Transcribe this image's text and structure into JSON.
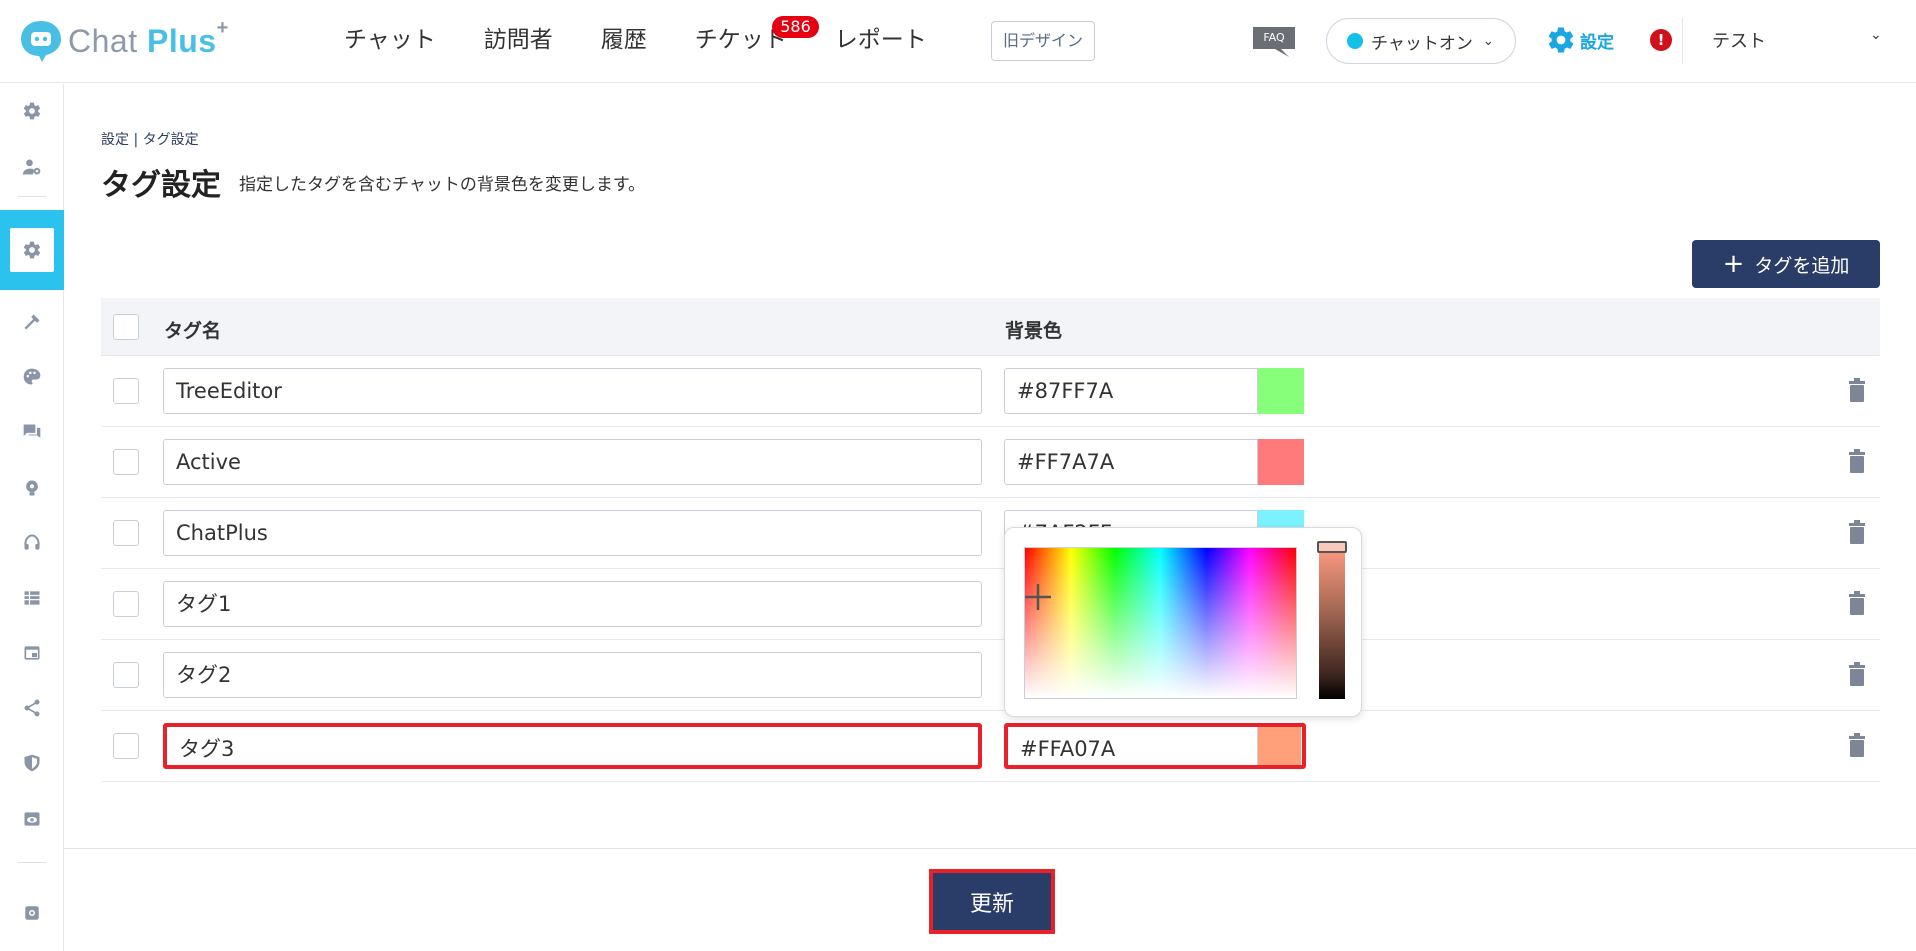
{
  "header": {
    "logo": {
      "brand": "Chat",
      "brand_suffix": "Plus",
      "mark": "+"
    },
    "nav": [
      {
        "label": "チャット"
      },
      {
        "label": "訪問者"
      },
      {
        "label": "履歴"
      },
      {
        "label": "チケット",
        "badge": "586"
      },
      {
        "label": "レポート"
      }
    ],
    "old_design_label": "旧デザイン",
    "faq_label": "FAQ",
    "status_label": "チャットオン",
    "settings_label": "設定",
    "alert_symbol": "!",
    "user_name": "テスト"
  },
  "sidebar": {
    "icons": [
      "gear-icon",
      "user-gear-icon",
      "gear-icon",
      "tools-icon",
      "palette-icon",
      "chat-icon",
      "bulb-icon",
      "headset-icon",
      "table-icon",
      "window-icon",
      "share-icon",
      "shield-icon",
      "eye-icon",
      "settings-icon"
    ],
    "active_index": 2
  },
  "breadcrumb": {
    "root": "設定",
    "current": "タグ設定"
  },
  "page": {
    "title": "タグ設定",
    "description": "指定したタグを含むチャットの背景色を変更します。",
    "add_button_label": "タグを追加"
  },
  "table": {
    "headers": {
      "name": "タグ名",
      "color": "背景色"
    },
    "rows": [
      {
        "name": "TreeEditor",
        "color": "#87FF7A",
        "swatch": "#87FF7A"
      },
      {
        "name": "Active",
        "color": "#FF7A7A",
        "swatch": "#FF7A7A"
      },
      {
        "name": "ChatPlus",
        "color": "#7AF2FF",
        "swatch": "#7AF2FF"
      },
      {
        "name": "タグ1",
        "color": "",
        "swatch": ""
      },
      {
        "name": "タグ2",
        "color": "",
        "swatch": ""
      },
      {
        "name": "タグ3",
        "color": "#FFA07A",
        "swatch": "#FFA07A"
      }
    ]
  },
  "footer": {
    "update_label": "更新"
  },
  "colors": {
    "primary": "#2a3c68",
    "accent": "#2bc3ee",
    "highlight": "#e8212a",
    "badge": "#e60012"
  }
}
